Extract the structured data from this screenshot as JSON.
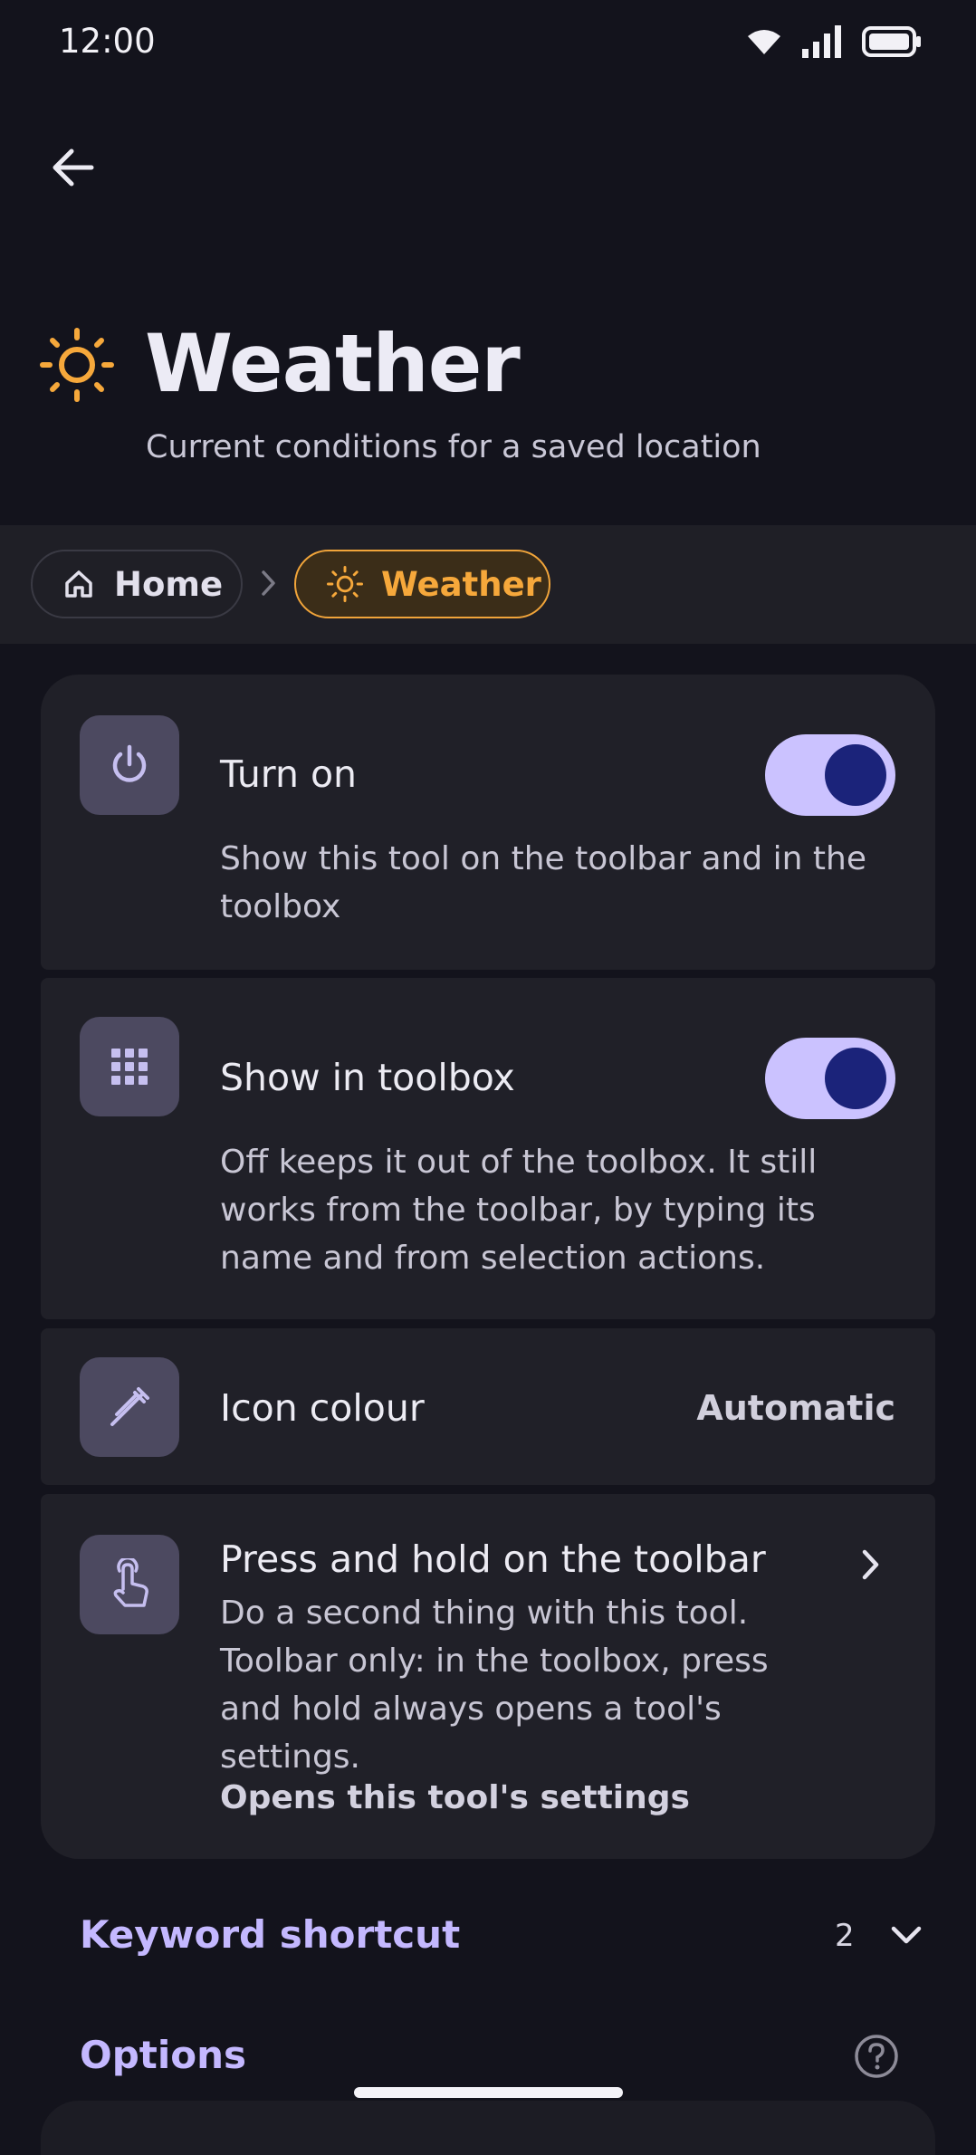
{
  "status_bar": {
    "time": "12:00",
    "icons": [
      "wifi-icon",
      "signal-icon",
      "battery-icon"
    ]
  },
  "header": {
    "back_icon": "arrow-left-icon",
    "icon": "sun-icon",
    "title": "Weather",
    "subtitle": "Current conditions for a saved location"
  },
  "breadcrumb": {
    "home_label": "Home",
    "home_icon": "home-icon",
    "separator_icon": "chevron-right-icon",
    "current_label": "Weather",
    "current_icon": "sun-icon"
  },
  "settings": {
    "turn_on": {
      "icon": "power-icon",
      "title": "Turn on",
      "description": "Show this tool on the toolbar and in the toolbox",
      "enabled": true
    },
    "show_in_toolbox": {
      "icon": "grid-icon",
      "title": "Show in toolbox",
      "description": "Off keeps it out of the toolbox. It still works from the toolbar, by typing its name and from selection actions.",
      "enabled": true
    },
    "icon_colour": {
      "icon": "eyedropper-icon",
      "title": "Icon colour",
      "value": "Automatic"
    },
    "press_and_hold": {
      "icon": "touch-hand-icon",
      "title": "Press and hold on the toolbar",
      "description": "Do a second thing with this tool. Toolbar only: in the toolbox, press and hold always opens a tool's settings.",
      "value": "Opens this tool's settings",
      "chevron_icon": "chevron-right-icon"
    }
  },
  "sections": {
    "keyword_shortcut": {
      "label": "Keyword shortcut",
      "count": "2",
      "expand_icon": "chevron-down-icon"
    },
    "options": {
      "label": "Options",
      "help_icon": "help-circle-icon"
    }
  },
  "colors": {
    "background": "#13131c",
    "card": "#202028",
    "accent": "#c4b8ff",
    "sun": "#f6a83b",
    "toggle_track": "#cbc2ff",
    "toggle_knob": "#1b237a"
  }
}
